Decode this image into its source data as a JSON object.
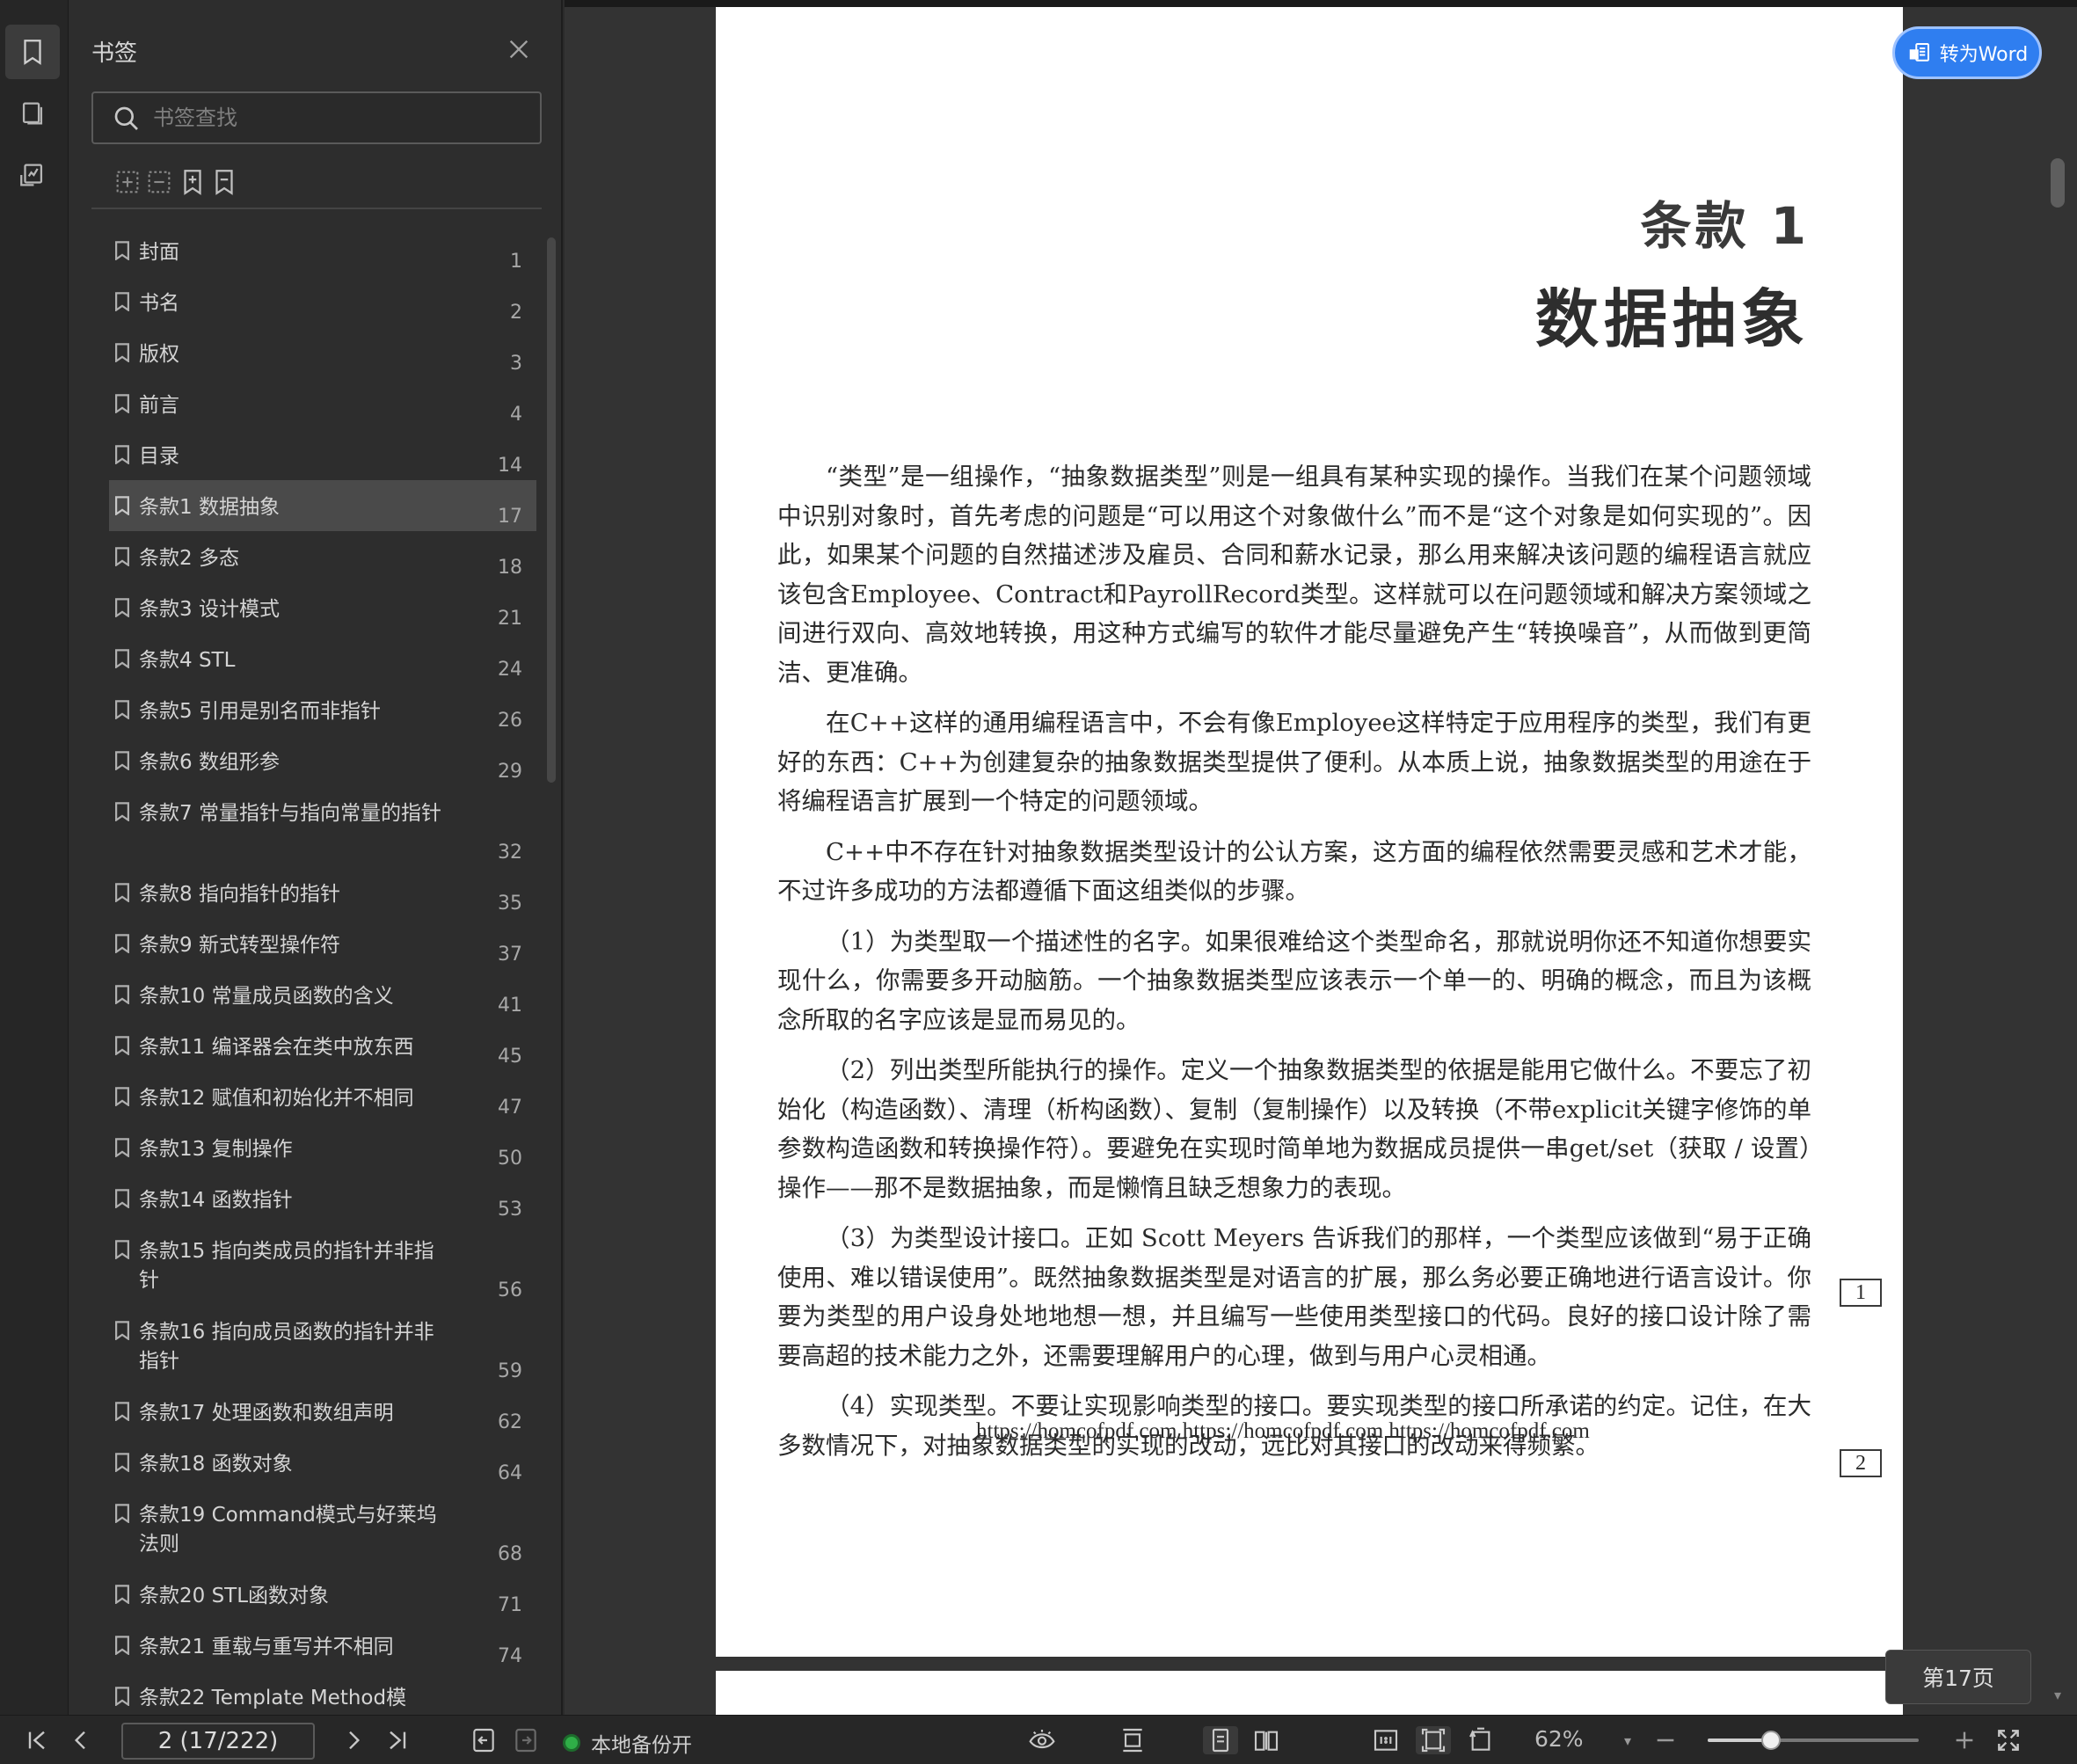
{
  "sidebar": {
    "title": "书签",
    "search_placeholder": "书签查找",
    "items": [
      {
        "label": "封面",
        "page": "1"
      },
      {
        "label": "书名",
        "page": "2"
      },
      {
        "label": "版权",
        "page": "3"
      },
      {
        "label": "前言",
        "page": "4"
      },
      {
        "label": "目录",
        "page": "14"
      },
      {
        "label": "条款1  数据抽象",
        "page": "17",
        "active": true
      },
      {
        "label": "条款2  多态",
        "page": "18"
      },
      {
        "label": "条款3  设计模式",
        "page": "21"
      },
      {
        "label": "条款4  STL",
        "page": "24"
      },
      {
        "label": "条款5  引用是别名而非指针",
        "page": "26"
      },
      {
        "label": "条款6  数组形参",
        "page": "29"
      },
      {
        "label": "条款7  常量指针与指向常量的指针",
        "page": "32"
      },
      {
        "label": "条款8  指向指针的指针",
        "page": "35"
      },
      {
        "label": "条款9  新式转型操作符",
        "page": "37"
      },
      {
        "label": "条款10  常量成员函数的含义",
        "page": "41"
      },
      {
        "label": "条款11  编译器会在类中放东西",
        "page": "45"
      },
      {
        "label": "条款12  赋值和初始化并不相同",
        "page": "47"
      },
      {
        "label": "条款13  复制操作",
        "page": "50"
      },
      {
        "label": "条款14  函数指针",
        "page": "53"
      },
      {
        "label": "条款15  指向类成员的指针并非指针",
        "page": "56"
      },
      {
        "label": "条款16  指向成员函数的指针并非指针",
        "page": "59"
      },
      {
        "label": "条款17  处理函数和数组声明",
        "page": "62"
      },
      {
        "label": "条款18  函数对象",
        "page": "64"
      },
      {
        "label": "条款19  Command模式与好莱坞法则",
        "page": "68"
      },
      {
        "label": "条款20  STL函数对象",
        "page": "71"
      },
      {
        "label": "条款21  重载与重写并不相同",
        "page": "74"
      },
      {
        "label": "条款22  Template Method模",
        "page": ""
      }
    ]
  },
  "document": {
    "chapter_number": "条款 1",
    "chapter_title": "数据抽象",
    "paragraphs": [
      "“类型”是一组操作，“抽象数据类型”则是一组具有某种实现的操作。当我们在某个问题领域中识别对象时，首先考虑的问题是“可以用这个对象做什么”而不是“这个对象是如何实现的”。因此，如果某个问题的自然描述涉及雇员、合同和薪水记录，那么用来解决该问题的编程语言就应该包含Employee、Contract和PayrollRecord类型。这样就可以在问题领域和解决方案领域之间进行双向、高效地转换，用这种方式编写的软件才能尽量避免产生“转换噪音”，从而做到更简洁、更准确。",
      "在C++这样的通用编程语言中，不会有像Employee这样特定于应用程序的类型，我们有更好的东西：C++为创建复杂的抽象数据类型提供了便利。从本质上说，抽象数据类型的用途在于将编程语言扩展到一个特定的问题领域。",
      "C++中不存在针对抽象数据类型设计的公认方案，这方面的编程依然需要灵感和艺术才能，不过许多成功的方法都遵循下面这组类似的步骤。",
      "（1）为类型取一个描述性的名字。如果很难给这个类型命名，那就说明你还不知道你想要实现什么，你需要多开动脑筋。一个抽象数据类型应该表示一个单一的、明确的概念，而且为该概念所取的名字应该是显而易见的。",
      "（2）列出类型所能执行的操作。定义一个抽象数据类型的依据是能用它做什么。不要忘了初始化（构造函数）、清理（析构函数）、复制（复制操作）以及转换（不带explicit关键字修饰的单参数构造函数和转换操作符）。要避免在实现时简单地为数据成员提供一串get/set（获取 / 设置）操作——那不是数据抽象，而是懒惰且缺乏想象力的表现。",
      "（3）为类型设计接口。正如 Scott Meyers 告诉我们的那样，一个类型应该做到“易于正确使用、难以错误使用”。既然抽象数据类型是对语言的扩展，那么务必要正确地进行语言设计。你要为类型的用户设身处地地想一想，并且编写一些使用类型接口的代码。良好的接口设计除了需要高超的技术能力之外，还需要理解用户的心理，做到与用户心灵相通。",
      "（4）实现类型。不要让实现影响类型的接口。要实现类型的接口所承诺的约定。记住，在大多数情况下，对抽象数据类型的实现的改动，远比对其接口的改动来得频繁。"
    ],
    "watermark": "https://homcofpdf.com https://homcofpdf.com https://homcofpdf.com",
    "margin_marks": [
      "1",
      "2"
    ]
  },
  "convert_button": "转为Word",
  "page_badge": "第17页",
  "bottombar": {
    "page_field": "2 (17/222)",
    "backup_status": "本地备份开",
    "zoom": "62%",
    "zoom_level": 0.3
  }
}
